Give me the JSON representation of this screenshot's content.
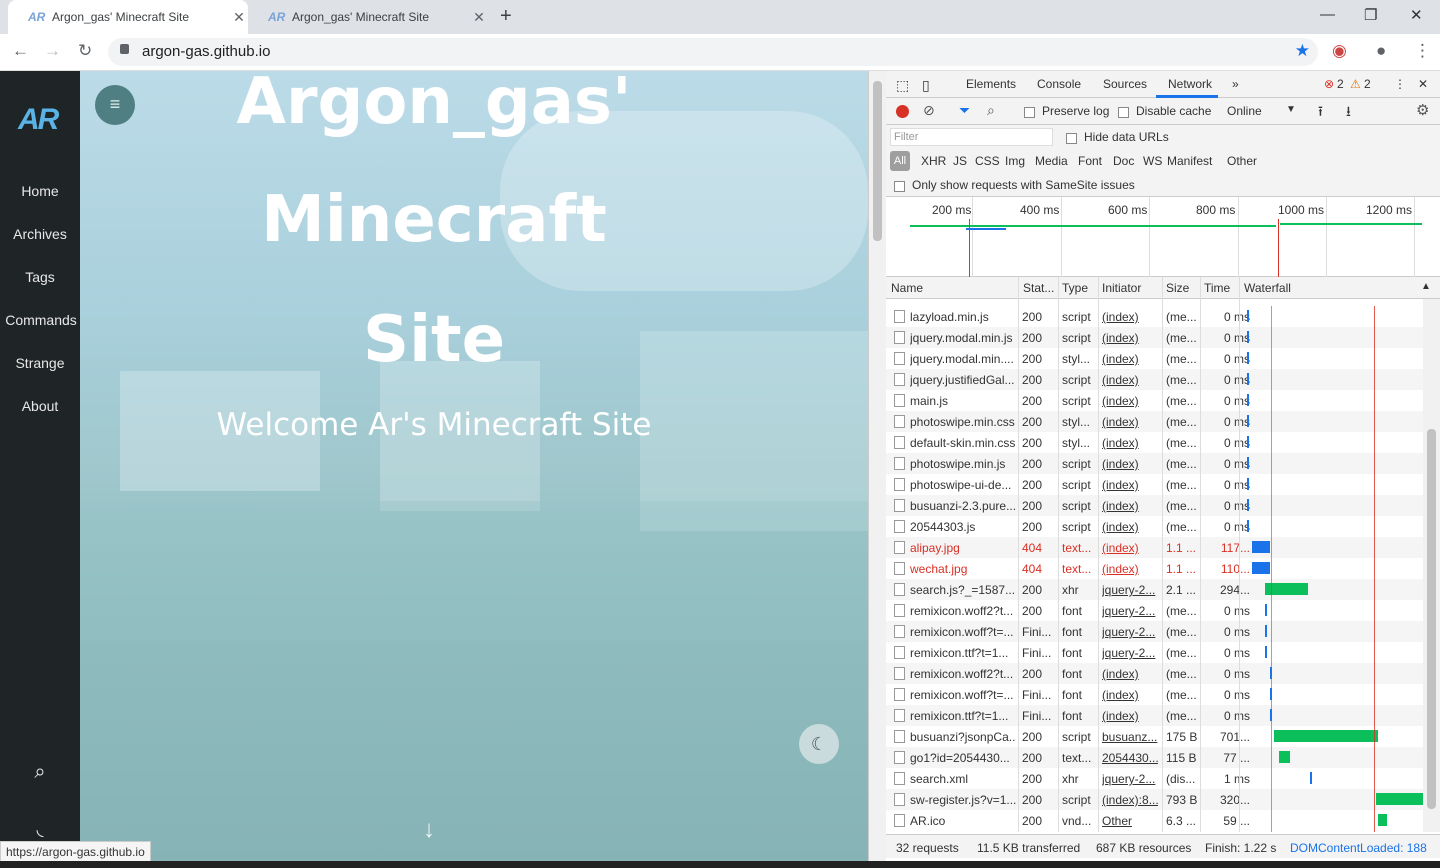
{
  "tabs": [
    {
      "title": "Argon_gas' Minecraft Site",
      "active": true
    },
    {
      "title": "Argon_gas' Minecraft Site",
      "active": false
    }
  ],
  "tab_favicon": "AR",
  "address": {
    "url": "argon-gas.github.io"
  },
  "site": {
    "logo": "AR",
    "nav": [
      "Home",
      "Archives",
      "Tags",
      "Commands",
      "Strange",
      "About"
    ],
    "hero_line1": "Argon_gas'",
    "hero_line2": "Minecraft",
    "hero_line3": "Site",
    "subtitle": "Welcome Ar's Minecraft Site",
    "status_url": "https://argon-gas.github.io"
  },
  "devtools": {
    "tabs": [
      "Elements",
      "Console",
      "Sources",
      "Network"
    ],
    "errors": "2",
    "warnings": "2",
    "preserve_log": "Preserve log",
    "disable_cache": "Disable cache",
    "throttle": "Online",
    "filter_placeholder": "Filter",
    "hide_data_urls": "Hide data URLs",
    "types": [
      "All",
      "XHR",
      "JS",
      "CSS",
      "Img",
      "Media",
      "Font",
      "Doc",
      "WS",
      "Manifest",
      "Other"
    ],
    "samesite": "Only show requests with SameSite issues",
    "ticks": [
      "200 ms",
      "400 ms",
      "600 ms",
      "800 ms",
      "1000 ms",
      "1200 ms"
    ],
    "columns": [
      "Name",
      "Stat...",
      "Type",
      "Initiator",
      "Size",
      "Time",
      "Waterfall"
    ],
    "rows": [
      {
        "name": "lazyload.min.js",
        "status": "200",
        "type": "script",
        "initiator": "(index)",
        "size": "(me...",
        "time": "0 ms",
        "err": false,
        "wf": [
          0.02,
          0.01,
          "#1a73e8"
        ]
      },
      {
        "name": "jquery.modal.min.js",
        "status": "200",
        "type": "script",
        "initiator": "(index)",
        "size": "(me...",
        "time": "0 ms",
        "err": false,
        "wf": [
          0.02,
          0.01,
          "#1a73e8"
        ]
      },
      {
        "name": "jquery.modal.min....",
        "status": "200",
        "type": "styl...",
        "initiator": "(index)",
        "size": "(me...",
        "time": "0 ms",
        "err": false,
        "wf": [
          0.02,
          0.01,
          "#1a73e8"
        ]
      },
      {
        "name": "jquery.justifiedGal...",
        "status": "200",
        "type": "script",
        "initiator": "(index)",
        "size": "(me...",
        "time": "0 ms",
        "err": false,
        "wf": [
          0.02,
          0.01,
          "#1a73e8"
        ]
      },
      {
        "name": "main.js",
        "status": "200",
        "type": "script",
        "initiator": "(index)",
        "size": "(me...",
        "time": "0 ms",
        "err": false,
        "wf": [
          0.02,
          0.01,
          "#1a73e8"
        ]
      },
      {
        "name": "photoswipe.min.css",
        "status": "200",
        "type": "styl...",
        "initiator": "(index)",
        "size": "(me...",
        "time": "0 ms",
        "err": false,
        "wf": [
          0.02,
          0.01,
          "#1a73e8"
        ]
      },
      {
        "name": "default-skin.min.css",
        "status": "200",
        "type": "styl...",
        "initiator": "(index)",
        "size": "(me...",
        "time": "0 ms",
        "err": false,
        "wf": [
          0.02,
          0.01,
          "#1a73e8"
        ]
      },
      {
        "name": "photoswipe.min.js",
        "status": "200",
        "type": "script",
        "initiator": "(index)",
        "size": "(me...",
        "time": "0 ms",
        "err": false,
        "wf": [
          0.02,
          0.01,
          "#1a73e8"
        ]
      },
      {
        "name": "photoswipe-ui-de...",
        "status": "200",
        "type": "script",
        "initiator": "(index)",
        "size": "(me...",
        "time": "0 ms",
        "err": false,
        "wf": [
          0.02,
          0.01,
          "#1a73e8"
        ]
      },
      {
        "name": "busuanzi-2.3.pure....",
        "status": "200",
        "type": "script",
        "initiator": "(index)",
        "size": "(me...",
        "time": "0 ms",
        "err": false,
        "wf": [
          0.02,
          0.01,
          "#1a73e8"
        ]
      },
      {
        "name": "20544303.js",
        "status": "200",
        "type": "script",
        "initiator": "(index)",
        "size": "(me...",
        "time": "0 ms",
        "err": false,
        "wf": [
          0.02,
          0.01,
          "#1a73e8"
        ]
      },
      {
        "name": "alipay.jpg",
        "status": "404",
        "type": "text...",
        "initiator": "(index)",
        "size": "1.1 ...",
        "time": "117...",
        "err": true,
        "wf": [
          0.05,
          0.1,
          "#1a73e8"
        ]
      },
      {
        "name": "wechat.jpg",
        "status": "404",
        "type": "text...",
        "initiator": "(index)",
        "size": "1.1 ...",
        "time": "110...",
        "err": true,
        "wf": [
          0.05,
          0.1,
          "#1a73e8"
        ]
      },
      {
        "name": "search.js?_=1587...",
        "status": "200",
        "type": "xhr",
        "initiator": "jquery-2...",
        "size": "2.1 ...",
        "time": "294...",
        "err": false,
        "wf": [
          0.12,
          0.24,
          "#0bbf5a"
        ]
      },
      {
        "name": "remixicon.woff2?t...",
        "status": "200",
        "type": "font",
        "initiator": "jquery-2...",
        "size": "(me...",
        "time": "0 ms",
        "err": false,
        "wf": [
          0.12,
          0.01,
          "#1a73e8"
        ]
      },
      {
        "name": "remixicon.woff?t=...",
        "status": "Fini...",
        "type": "font",
        "initiator": "jquery-2...",
        "size": "(me...",
        "time": "0 ms",
        "err": false,
        "wf": [
          0.12,
          0.0,
          "#1a73e8"
        ]
      },
      {
        "name": "remixicon.ttf?t=1...",
        "status": "Fini...",
        "type": "font",
        "initiator": "jquery-2...",
        "size": "(me...",
        "time": "0 ms",
        "err": false,
        "wf": [
          0.12,
          0.0,
          "#1a73e8"
        ]
      },
      {
        "name": "remixicon.woff2?t...",
        "status": "200",
        "type": "font",
        "initiator": "(index)",
        "size": "(me...",
        "time": "0 ms",
        "err": false,
        "wf": [
          0.15,
          0.01,
          "#1a73e8"
        ]
      },
      {
        "name": "remixicon.woff?t=...",
        "status": "Fini...",
        "type": "font",
        "initiator": "(index)",
        "size": "(me...",
        "time": "0 ms",
        "err": false,
        "wf": [
          0.15,
          0.0,
          "#1a73e8"
        ]
      },
      {
        "name": "remixicon.ttf?t=1...",
        "status": "Fini...",
        "type": "font",
        "initiator": "(index)",
        "size": "(me...",
        "time": "0 ms",
        "err": false,
        "wf": [
          0.15,
          0.0,
          "#1a73e8"
        ]
      },
      {
        "name": "busuanzi?jsonpCa...",
        "status": "200",
        "type": "script",
        "initiator": "busuanz...",
        "size": "175 B",
        "time": "701...",
        "err": false,
        "wf": [
          0.17,
          0.58,
          "#0bbf5a"
        ]
      },
      {
        "name": "go1?id=2054430...",
        "status": "200",
        "type": "text...",
        "initiator": "2054430...",
        "size": "115 B",
        "time": "77 ...",
        "err": false,
        "wf": [
          0.2,
          0.06,
          "#0bbf5a"
        ]
      },
      {
        "name": "search.xml",
        "status": "200",
        "type": "xhr",
        "initiator": "jquery-2...",
        "size": "(dis...",
        "time": "1 ms",
        "err": false,
        "wf": [
          0.37,
          0.01,
          "#1a73e8"
        ]
      },
      {
        "name": "sw-register.js?v=1...",
        "status": "200",
        "type": "script",
        "initiator": "(index):8...",
        "size": "793 B",
        "time": "320...",
        "err": false,
        "wf": [
          0.74,
          0.26,
          "#0bbf5a"
        ]
      },
      {
        "name": "AR.ico",
        "status": "200",
        "type": "vnd...",
        "initiator": "Other",
        "size": "6.3 ...",
        "time": "59 ...",
        "err": false,
        "wf": [
          0.75,
          0.05,
          "#0bbf5a"
        ]
      }
    ],
    "summary": {
      "requests": "32 requests",
      "transferred": "11.5 KB transferred",
      "resources": "687 KB resources",
      "finish": "Finish: 1.22 s",
      "dcl": "DOMContentLoaded: 188"
    }
  },
  "colors": {
    "accent": "#1a73e8",
    "error": "#d93025",
    "bar_green": "#0bbf5a",
    "sidebar": "#1f2426"
  }
}
